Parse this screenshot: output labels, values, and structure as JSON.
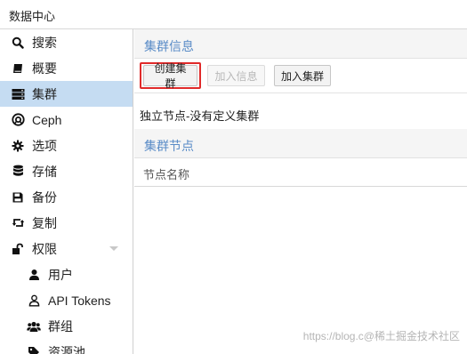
{
  "app": {
    "title": "数据中心"
  },
  "sidebar": {
    "items": [
      {
        "label": "搜索",
        "icon": "search-icon"
      },
      {
        "label": "概要",
        "icon": "book-icon"
      },
      {
        "label": "集群",
        "icon": "server-icon",
        "active": true
      },
      {
        "label": "Ceph",
        "icon": "ceph-icon"
      },
      {
        "label": "选项",
        "icon": "gear-icon"
      },
      {
        "label": "存储",
        "icon": "database-icon"
      },
      {
        "label": "备份",
        "icon": "floppy-icon"
      },
      {
        "label": "复制",
        "icon": "retweet-icon"
      },
      {
        "label": "权限",
        "icon": "unlock-icon",
        "expandable": true
      },
      {
        "label": "用户",
        "icon": "user-icon"
      },
      {
        "label": "API Tokens",
        "icon": "person-outline-icon"
      },
      {
        "label": "群组",
        "icon": "users-icon"
      },
      {
        "label": "资源池",
        "icon": "tags-icon"
      }
    ]
  },
  "main": {
    "cluster_info_title": "集群信息",
    "toolbar": {
      "create_cluster": "创建集群",
      "join_info": "加入信息",
      "join_cluster": "加入集群"
    },
    "standalone_text": "独立节点-没有定义集群",
    "cluster_nodes_title": "集群节点",
    "column_node_name": "节点名称"
  },
  "watermark": "https://blog.c@稀土掘金技术社区",
  "colors": {
    "accent": "#5a8cc7",
    "active_bg": "#c5dcf2",
    "highlight_border": "#e02a2a"
  }
}
